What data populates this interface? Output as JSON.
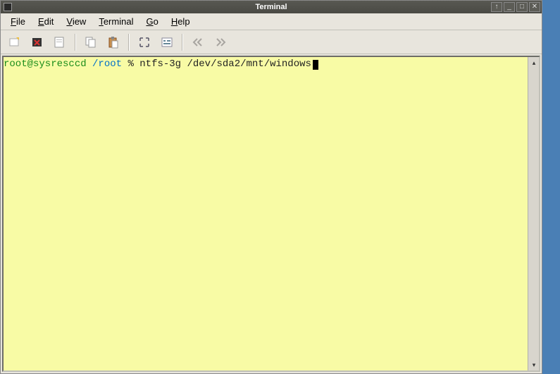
{
  "titlebar": {
    "title": "Terminal",
    "controls": {
      "up": "↑",
      "min": "_",
      "max": "□",
      "close": "✕"
    }
  },
  "menubar": {
    "file": "File",
    "edit": "Edit",
    "view": "View",
    "terminal": "Terminal",
    "go": "Go",
    "help": "Help"
  },
  "prompt": {
    "user_host": "root@sysresccd",
    "path": "/root",
    "symbol": "%",
    "command": "ntfs-3g /dev/sda2/mnt/windows"
  },
  "scrollbar": {
    "up": "▴",
    "down": "▾"
  }
}
